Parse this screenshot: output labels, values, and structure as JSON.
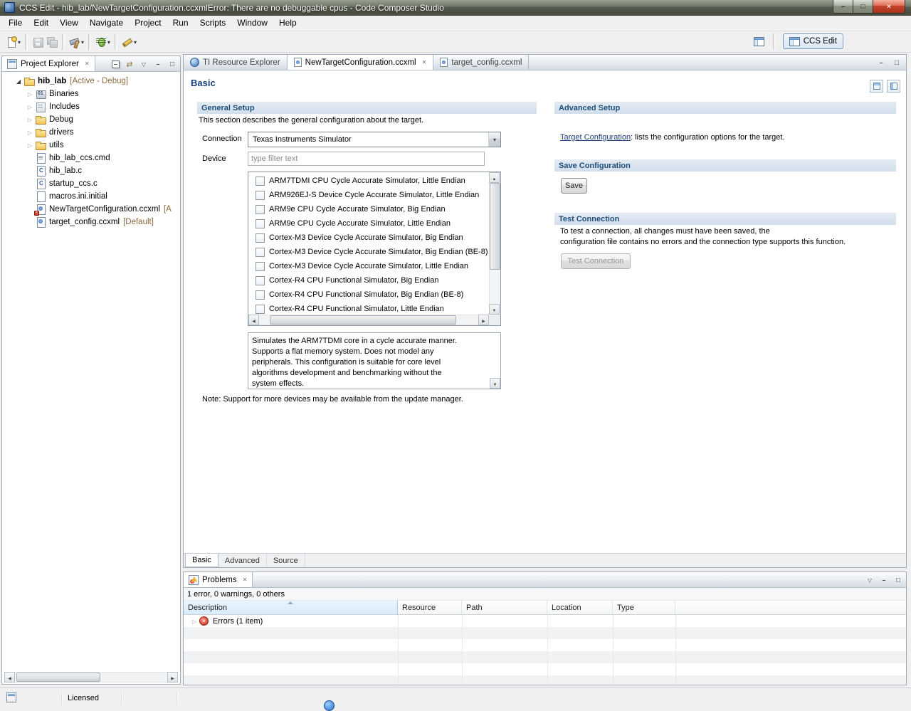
{
  "window": {
    "title": "CCS Edit - hib_lab/NewTargetConfiguration.ccxmlError: There are no debuggable cpus - Code Composer Studio"
  },
  "colors": {
    "heading_blue": "#1f4e79",
    "link_blue": "#1a3c7e",
    "error_red": "#c62f1c",
    "decoration_brown": "#8c6a3f"
  },
  "menubar": {
    "items": [
      "File",
      "Edit",
      "View",
      "Navigate",
      "Project",
      "Run",
      "Scripts",
      "Window",
      "Help"
    ]
  },
  "toolbar": {
    "perspective_button": "CCS Edit"
  },
  "explorer": {
    "title": "Project Explorer",
    "root": {
      "label": "hib_lab",
      "decoration": "[Active - Debug]"
    },
    "items": [
      {
        "label": "Binaries"
      },
      {
        "label": "Includes"
      },
      {
        "label": "Debug"
      },
      {
        "label": "drivers"
      },
      {
        "label": "utils"
      },
      {
        "label": "hib_lab_ccs.cmd"
      },
      {
        "label": "hib_lab.c"
      },
      {
        "label": "startup_ccs.c"
      },
      {
        "label": "macros.ini.initial"
      },
      {
        "label": "NewTargetConfiguration.ccxml",
        "decoration": "[A"
      },
      {
        "label": "target_config.ccxml",
        "decoration": "[Default]"
      }
    ]
  },
  "editor": {
    "tabs": [
      {
        "label": "TI Resource Explorer"
      },
      {
        "label": "NewTargetConfiguration.ccxml"
      },
      {
        "label": "target_config.ccxml"
      }
    ],
    "form": {
      "title": "Basic",
      "general": {
        "heading": "General Setup",
        "intro": "This section describes the general configuration about the target.",
        "connection_label": "Connection",
        "connection_value": "Texas Instruments Simulator",
        "device_label": "Device",
        "filter_hint": "type filter text",
        "devices": [
          "ARM7TDMI CPU Cycle Accurate Simulator, Little Endian",
          "ARM926EJ-S Device Cycle Accurate Simulator, Little Endian",
          "ARM9e CPU Cycle Accurate Simulator, Big Endian",
          "ARM9e CPU Cycle Accurate Simulator, Little Endian",
          "Cortex-M3 Device Cycle Accurate Simulator, Big Endian",
          "Cortex-M3 Device Cycle Accurate Simulator, Big Endian (BE-8)",
          "Cortex-M3 Device Cycle Accurate Simulator, Little Endian",
          "Cortex-R4 CPU Functional Simulator, Big Endian",
          "Cortex-R4 CPU Functional Simulator, Big Endian (BE-8)",
          "Cortex-R4 CPU Functional Simulator, Little Endian"
        ],
        "device_description": "Simulates the ARM7TDMI core in a cycle accurate manner. Supports a flat memory system. Does not model any peripherals. This configuration is suitable for core level algorithms development and benchmarking without the system effects.",
        "note": "Note: Support for more devices may be available from the update manager."
      },
      "advanced": {
        "heading": "Advanced Setup",
        "link": "Target Configuration",
        "link_rest": ": lists the configuration options for the target."
      },
      "save": {
        "heading": "Save Configuration",
        "button": "Save"
      },
      "test": {
        "heading": "Test Connection",
        "line1": "To test a connection, all changes must have been saved, the",
        "line2": "configuration file contains no errors and the connection type supports this function.",
        "button": "Test Connection"
      },
      "bottom_tabs": [
        "Basic",
        "Advanced",
        "Source"
      ]
    }
  },
  "problems": {
    "title": "Problems",
    "summary": "1 error, 0 warnings, 0 others",
    "columns": [
      "Description",
      "Resource",
      "Path",
      "Location",
      "Type"
    ],
    "rows": [
      {
        "label": "Errors (1 item)"
      }
    ]
  },
  "statusbar": {
    "license": "Licensed"
  }
}
